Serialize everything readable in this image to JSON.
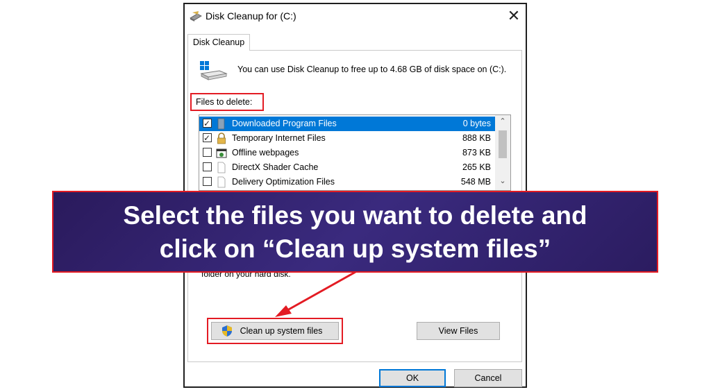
{
  "window": {
    "title": "Disk Cleanup for  (C:)",
    "close_glyph": "✕",
    "tab_label": "Disk Cleanup",
    "intro_text": "You can use Disk Cleanup to free up to 4.68 GB of disk space on (C:).",
    "files_label": "Files to delete:",
    "description_fragment": "folder on your hard disk.",
    "cleanup_button": "Clean up system files",
    "view_files_button": "View Files",
    "ok_button": "OK",
    "cancel_button": "Cancel"
  },
  "files": [
    {
      "name": "Downloaded Program Files",
      "size": "0 bytes",
      "checked": true,
      "selected": true,
      "icon": "folder-icon"
    },
    {
      "name": "Temporary Internet Files",
      "size": "888 KB",
      "checked": true,
      "selected": false,
      "icon": "lock-icon"
    },
    {
      "name": "Offline webpages",
      "size": "873 KB",
      "checked": false,
      "selected": false,
      "icon": "webpage-icon"
    },
    {
      "name": "DirectX Shader Cache",
      "size": "265 KB",
      "checked": false,
      "selected": false,
      "icon": "file-icon"
    },
    {
      "name": "Delivery Optimization Files",
      "size": "548 MB",
      "checked": false,
      "selected": false,
      "icon": "file-icon"
    }
  ],
  "banner": {
    "line1": "Select the files you want to delete and",
    "line2": "click on “Clean up system files”"
  },
  "colors": {
    "accent": "#0078d7",
    "annotation_red": "#e31b23",
    "banner_bg": "#2f1f6b"
  }
}
